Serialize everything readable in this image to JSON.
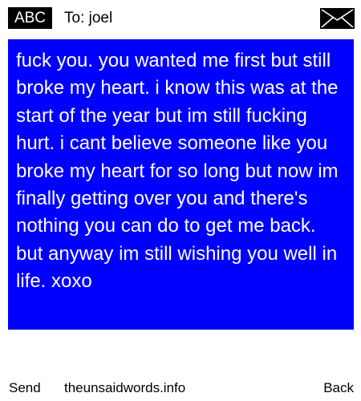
{
  "header": {
    "mode": "ABC",
    "to": "To: joel",
    "send_icon": "envelope-icon"
  },
  "message": {
    "text": "fuck you. you wanted me first but still broke my heart. i know this was at the start of the year but im still fucking hurt. i cant believe someone like you broke my heart for so long but now im finally getting over you and there's nothing you can do to get me back. but anyway im still wishing you well in life. xoxo"
  },
  "softkeys": {
    "left": "Send",
    "center": "theunsaidwords.info",
    "right": "Back"
  },
  "colors": {
    "message_background": "#0000ff",
    "message_text": "#ffffff",
    "badge_background": "#000000"
  }
}
